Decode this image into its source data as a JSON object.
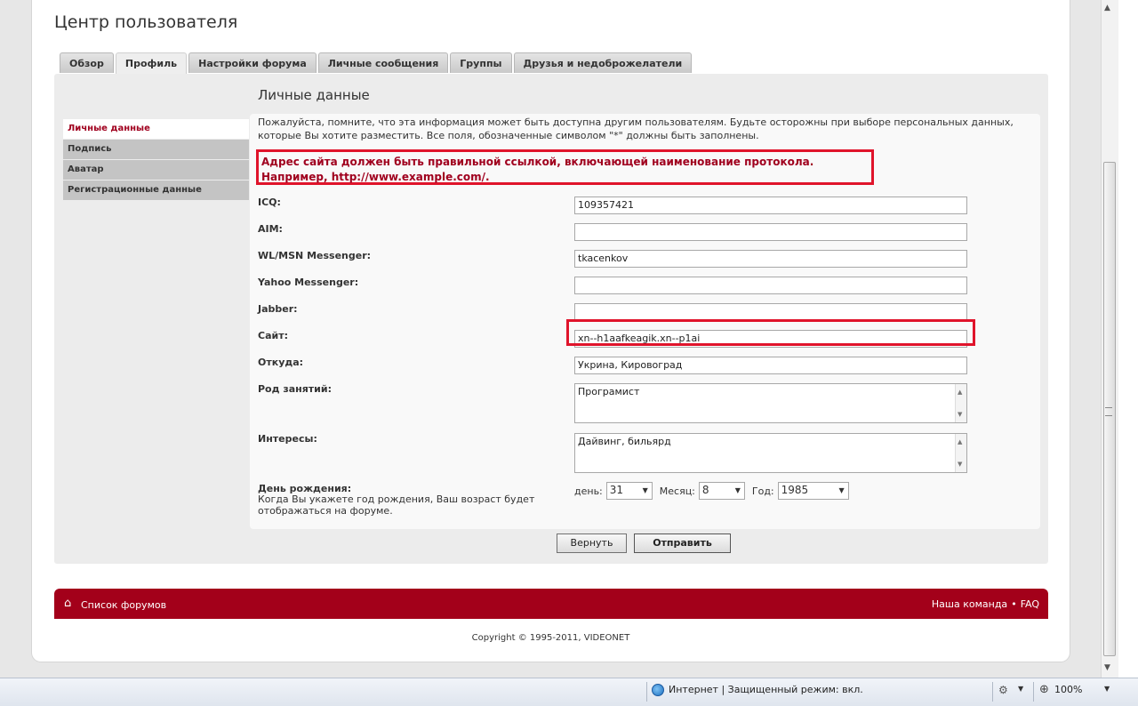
{
  "page": {
    "title": "Центр пользователя"
  },
  "tabs": [
    {
      "label": "Обзор",
      "active": false
    },
    {
      "label": "Профиль",
      "active": true
    },
    {
      "label": "Настройки форума",
      "active": false
    },
    {
      "label": "Личные сообщения",
      "active": false
    },
    {
      "label": "Группы",
      "active": false
    },
    {
      "label": "Друзья и недоброжелатели",
      "active": false
    }
  ],
  "sidebar": {
    "items": [
      {
        "label": "Личные данные",
        "active": true
      },
      {
        "label": "Подпись",
        "active": false
      },
      {
        "label": "Аватар",
        "active": false
      },
      {
        "label": "Регистрационные данные",
        "active": false
      }
    ]
  },
  "content": {
    "title": "Личные данные",
    "notice": "Пожалуйста, помните, что эта информация может быть доступна другим пользователям. Будьте осторожны при выборе персональных данных, которые Вы хотите разместить. Все поля, обозначенные символом \"*\" должны быть заполнены.",
    "error": "Адрес сайта должен быть правильной ссылкой, включающей наименование протокола. Например, http://www.example.com/."
  },
  "fields": {
    "icq": {
      "label": "ICQ:",
      "value": "109357421"
    },
    "aim": {
      "label": "AIM:",
      "value": ""
    },
    "msn": {
      "label": "WL/MSN Messenger:",
      "value": "tkacenkov"
    },
    "yahoo": {
      "label": "Yahoo Messenger:",
      "value": ""
    },
    "jabber": {
      "label": "Jabber:",
      "value": ""
    },
    "site": {
      "label": "Сайт:",
      "value": "xn--h1aafkeagik.xn--p1ai"
    },
    "location": {
      "label": "Откуда:",
      "value": "Укрина, Кировоград"
    },
    "occupation": {
      "label": "Род занятий:",
      "value": "Програмист"
    },
    "interests": {
      "label": "Интересы:",
      "value": "Дайвинг, бильярд"
    }
  },
  "birthday": {
    "label": "День рождения:",
    "help": "Когда Вы укажете год рождения, Ваш возраст будет отображаться на форуме.",
    "day_label": "день:",
    "day": "31",
    "month_label": "Месяц:",
    "month": "8",
    "year_label": "Год:",
    "year": "1985"
  },
  "buttons": {
    "reset": "Вернуть",
    "submit": "Отправить"
  },
  "footer": {
    "forums_link": "Список форумов",
    "team_link": "Наша команда",
    "bullet": "•",
    "faq_link": "FAQ",
    "copyright_prefix": "Copyright © 1995-2011,",
    "copyright_brand": "VIDEONET"
  },
  "status": {
    "zone": "Интернет | Защищенный режим: вкл.",
    "zoom": "100%"
  }
}
